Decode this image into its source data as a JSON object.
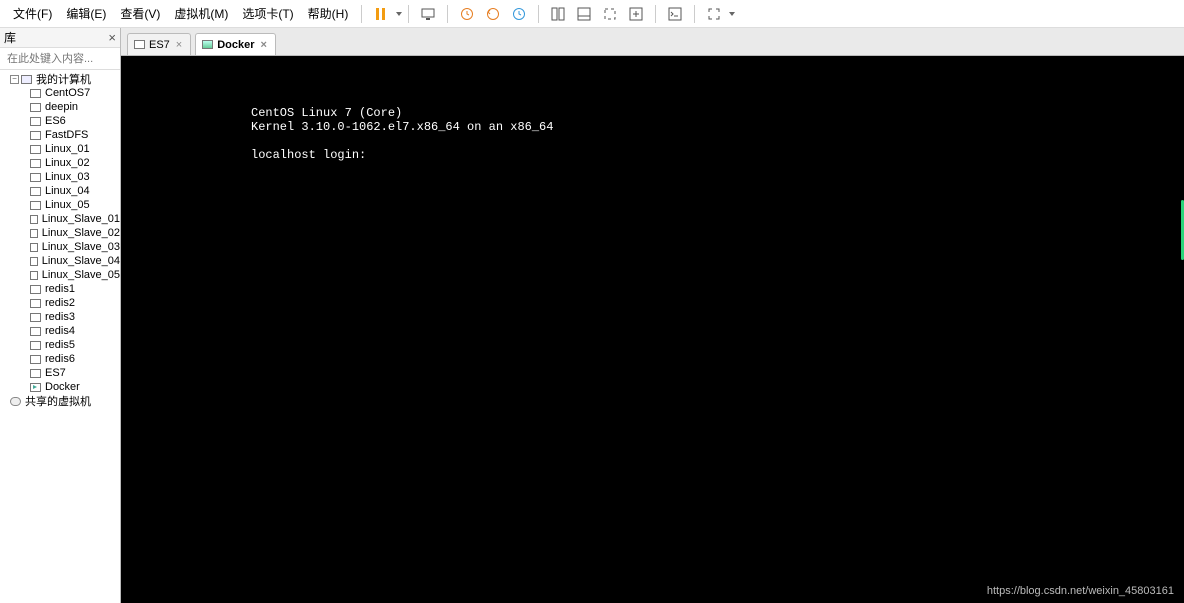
{
  "menu": {
    "file": "文件(F)",
    "edit": "编辑(E)",
    "view": "查看(V)",
    "vm": "虚拟机(M)",
    "tabs": "选项卡(T)",
    "help": "帮助(H)"
  },
  "sidebar": {
    "title": "库",
    "close": "×",
    "search_placeholder": "在此处键入内容...",
    "root": "我的计算机",
    "items": [
      "CentOS7",
      "deepin",
      "ES6",
      "FastDFS",
      "Linux_01",
      "Linux_02",
      "Linux_03",
      "Linux_04",
      "Linux_05",
      "Linux_Slave_01",
      "Linux_Slave_02",
      "Linux_Slave_03",
      "Linux_Slave_04",
      "Linux_Slave_05",
      "redis1",
      "redis2",
      "redis3",
      "redis4",
      "redis5",
      "redis6",
      "ES7",
      "Docker"
    ],
    "shared": "共享的虚拟机"
  },
  "tabs": [
    {
      "label": "ES7",
      "active": false
    },
    {
      "label": "Docker",
      "active": true
    }
  ],
  "terminal": {
    "line1": "CentOS Linux 7 (Core)",
    "line2": "Kernel 3.10.0-1062.el7.x86_64 on an x86_64",
    "blank": "",
    "line3": "localhost login:"
  },
  "watermark": "https://blog.csdn.net/weixin_45803161"
}
